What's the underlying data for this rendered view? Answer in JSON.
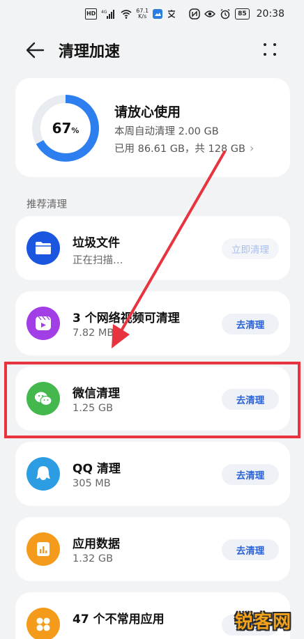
{
  "status_bar": {
    "hd": "HD",
    "signal": "4G",
    "speed_top": "67.1",
    "speed_bottom": "K/s",
    "battery": "85",
    "time": "20:38"
  },
  "header": {
    "title": "清理加速"
  },
  "storage": {
    "percent": "67",
    "percent_unit": "%",
    "percent_value": 0.67,
    "title": "请放心使用",
    "weekly": "本周自动清理 2.00 GB",
    "usage": "已用 86.61 GB，共 128 GB"
  },
  "section_label": "推荐清理",
  "items": [
    {
      "title": "垃圾文件",
      "sub": "正在扫描…",
      "button": "立即清理",
      "icon": "folder-icon",
      "color": "#1a56e0"
    },
    {
      "title": "3 个网络视频可清理",
      "sub": "7.82 MB",
      "button": "去清理",
      "icon": "video-icon",
      "color": "#a23ee6"
    },
    {
      "title": "微信清理",
      "sub": "1.25 GB",
      "button": "去清理",
      "icon": "wechat-icon",
      "color": "#45b84d"
    },
    {
      "title": "QQ 清理",
      "sub": "305 MB",
      "button": "去清理",
      "icon": "qq-icon",
      "color": "#2d9de3"
    },
    {
      "title": "应用数据",
      "sub": "1.32 GB",
      "button": "去清理",
      "icon": "app-data-icon",
      "color": "#f59b1b"
    },
    {
      "title": "47 个不常用应用",
      "sub": "",
      "button": "去清理",
      "icon": "apps-icon",
      "color": "#f59b1b"
    }
  ],
  "colors": {
    "ring": "#2d7ff0",
    "ring_track": "#e8ecf1",
    "annotation": "#e8343e",
    "accent": "#2a62d8"
  },
  "watermark": "锐客网"
}
